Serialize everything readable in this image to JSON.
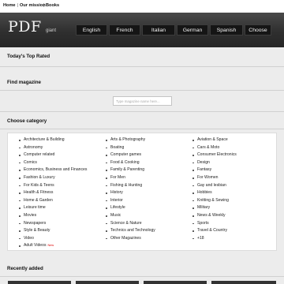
{
  "topnav": {
    "home": "Home",
    "mission": "Our mission",
    "books": "Books"
  },
  "header": {
    "logo": "PDF",
    "logo_sub": "giant",
    "languages": [
      "English",
      "French",
      "Italian",
      "German",
      "Spanish",
      "Choose"
    ]
  },
  "sections": {
    "top_rated": "Today's Top Rated",
    "find_magazine": "Find magazine",
    "choose_category": "Choose category",
    "recently_added": "Recently added"
  },
  "search": {
    "placeholder": "Type magazine name here..."
  },
  "categories": {
    "col1": [
      "Architecture & Building",
      "Astronomy",
      "Computer related",
      "Comics",
      "Economics, Business and Finances",
      "Fashion & Luxury",
      "For Kids & Teens",
      "Health & Fitness",
      "Home & Garden",
      "Leisure time",
      "Movies",
      "Newspapers",
      "Style & Beauty",
      "Video",
      "Adult Videos"
    ],
    "col1_badge": "New",
    "col2": [
      "Arts & Photography",
      "Boating",
      "Computer games",
      "Food & Cooking",
      "Family & Parenting",
      "For Men",
      "Fishing & Hunting",
      "History",
      "Interior",
      "Lifestyle",
      "Music",
      "Science & Nature",
      "Technics and Technology",
      "Other Magazines"
    ],
    "col3": [
      "Aviation & Space",
      "Cars & Moto",
      "Consumer Electronics",
      "Design",
      "Fantasy",
      "For Women",
      "Gay and lesbian",
      "Hobbies",
      "Knitting & Sewing",
      "Military",
      "News & Weekly",
      "Sports",
      "Travel & Country",
      "+18"
    ]
  }
}
